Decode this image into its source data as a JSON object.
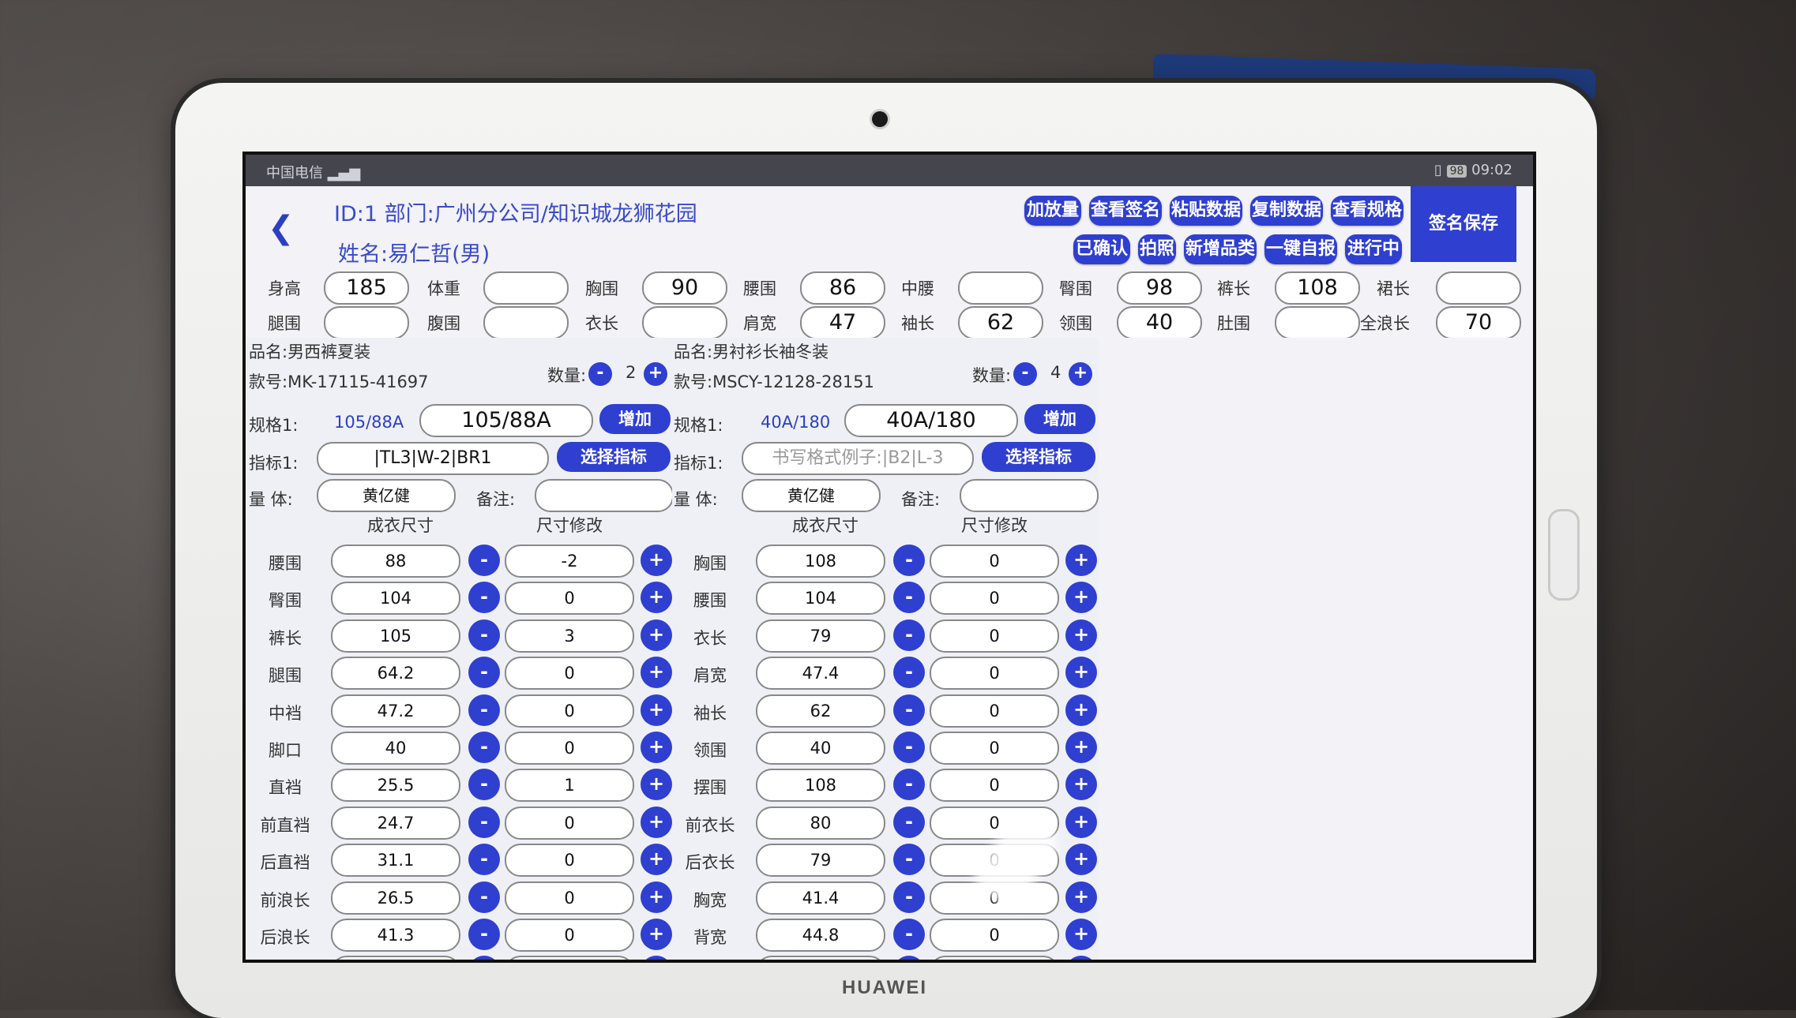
{
  "status_bar": {
    "carrier": "中国电信",
    "battery": "98",
    "time": "09:02"
  },
  "header": {
    "line1": "ID:1  部门:广州分公司/知识城龙狮花园",
    "line2": "姓名:易仁哲(男)",
    "buttons_row1": [
      "加放量",
      "查看签名",
      "粘贴数据",
      "复制数据",
      "查看规格"
    ],
    "buttons_row2": [
      "已确认",
      "拍照",
      "新增品类",
      "一键自报",
      "进行中"
    ],
    "save_label": "签名保存"
  },
  "measurements": {
    "row1": [
      {
        "label": "身高",
        "value": "185"
      },
      {
        "label": "体重",
        "value": ""
      },
      {
        "label": "胸围",
        "value": "90"
      },
      {
        "label": "腰围",
        "value": "86"
      },
      {
        "label": "中腰",
        "value": ""
      },
      {
        "label": "臀围",
        "value": "98"
      },
      {
        "label": "裤长",
        "value": "108"
      },
      {
        "label": "裙长",
        "value": ""
      }
    ],
    "row2": [
      {
        "label": "腿围",
        "value": ""
      },
      {
        "label": "腹围",
        "value": ""
      },
      {
        "label": "衣长",
        "value": ""
      },
      {
        "label": "肩宽",
        "value": "47"
      },
      {
        "label": "袖长",
        "value": "62"
      },
      {
        "label": "领围",
        "value": "40"
      },
      {
        "label": "肚围",
        "value": ""
      },
      {
        "label": "全浪长",
        "value": "70"
      }
    ]
  },
  "panels": [
    {
      "product": "品名:男西裤夏装",
      "code": "款号:MK-17115-41697",
      "qty_label": "数量:",
      "qty": "2",
      "spec_label": "规格1:",
      "spec_small": "105/88A",
      "spec_value": "105/88A",
      "add_label": "增加",
      "index_label": "指标1:",
      "index_value": "|TL3|W-2|BR1",
      "index_placeholder": "",
      "select_label": "选择指标",
      "body_label": "量 体:",
      "body_value": "黄亿健",
      "note_label": "备注:",
      "col1": "成衣尺寸",
      "col2": "尺寸修改",
      "rows": [
        {
          "label": "腰围",
          "size": "88",
          "adj": "-2"
        },
        {
          "label": "臀围",
          "size": "104",
          "adj": "0"
        },
        {
          "label": "裤长",
          "size": "105",
          "adj": "3"
        },
        {
          "label": "腿围",
          "size": "64.2",
          "adj": "0"
        },
        {
          "label": "中裆",
          "size": "47.2",
          "adj": "0"
        },
        {
          "label": "脚口",
          "size": "40",
          "adj": "0"
        },
        {
          "label": "直裆",
          "size": "25.5",
          "adj": "1"
        },
        {
          "label": "前直裆",
          "size": "24.7",
          "adj": "0"
        },
        {
          "label": "后直裆",
          "size": "31.1",
          "adj": "0"
        },
        {
          "label": "前浪长",
          "size": "26.5",
          "adj": "0"
        },
        {
          "label": "后浪长",
          "size": "41.3",
          "adj": "0"
        }
      ]
    },
    {
      "product": "品名:男衬衫长袖冬装",
      "code": "款号:MSCY-12128-28151",
      "qty_label": "数量:",
      "qty": "4",
      "spec_label": "规格1:",
      "spec_small": "40A/180",
      "spec_value": "40A/180",
      "add_label": "增加",
      "index_label": "指标1:",
      "index_value": "",
      "index_placeholder": "书写格式例子:|B2|L-3",
      "select_label": "选择指标",
      "body_label": "量 体:",
      "body_value": "黄亿健",
      "note_label": "备注:",
      "col1": "成衣尺寸",
      "col2": "尺寸修改",
      "rows": [
        {
          "label": "胸围",
          "size": "108",
          "adj": "0"
        },
        {
          "label": "腰围",
          "size": "104",
          "adj": "0"
        },
        {
          "label": "衣长",
          "size": "79",
          "adj": "0"
        },
        {
          "label": "肩宽",
          "size": "47.4",
          "adj": "0"
        },
        {
          "label": "袖长",
          "size": "62",
          "adj": "0"
        },
        {
          "label": "领围",
          "size": "40",
          "adj": "0"
        },
        {
          "label": "摆围",
          "size": "108",
          "adj": "0"
        },
        {
          "label": "前衣长",
          "size": "80",
          "adj": "0"
        },
        {
          "label": "后衣长",
          "size": "79",
          "adj": "0"
        },
        {
          "label": "胸宽",
          "size": "41.4",
          "adj": "0"
        },
        {
          "label": "背宽",
          "size": "44.8",
          "adj": "0"
        }
      ]
    }
  ],
  "device_brand": "HUAWEI",
  "icons": {
    "back": "back-icon",
    "minus": "minus-icon",
    "plus": "plus-icon"
  }
}
